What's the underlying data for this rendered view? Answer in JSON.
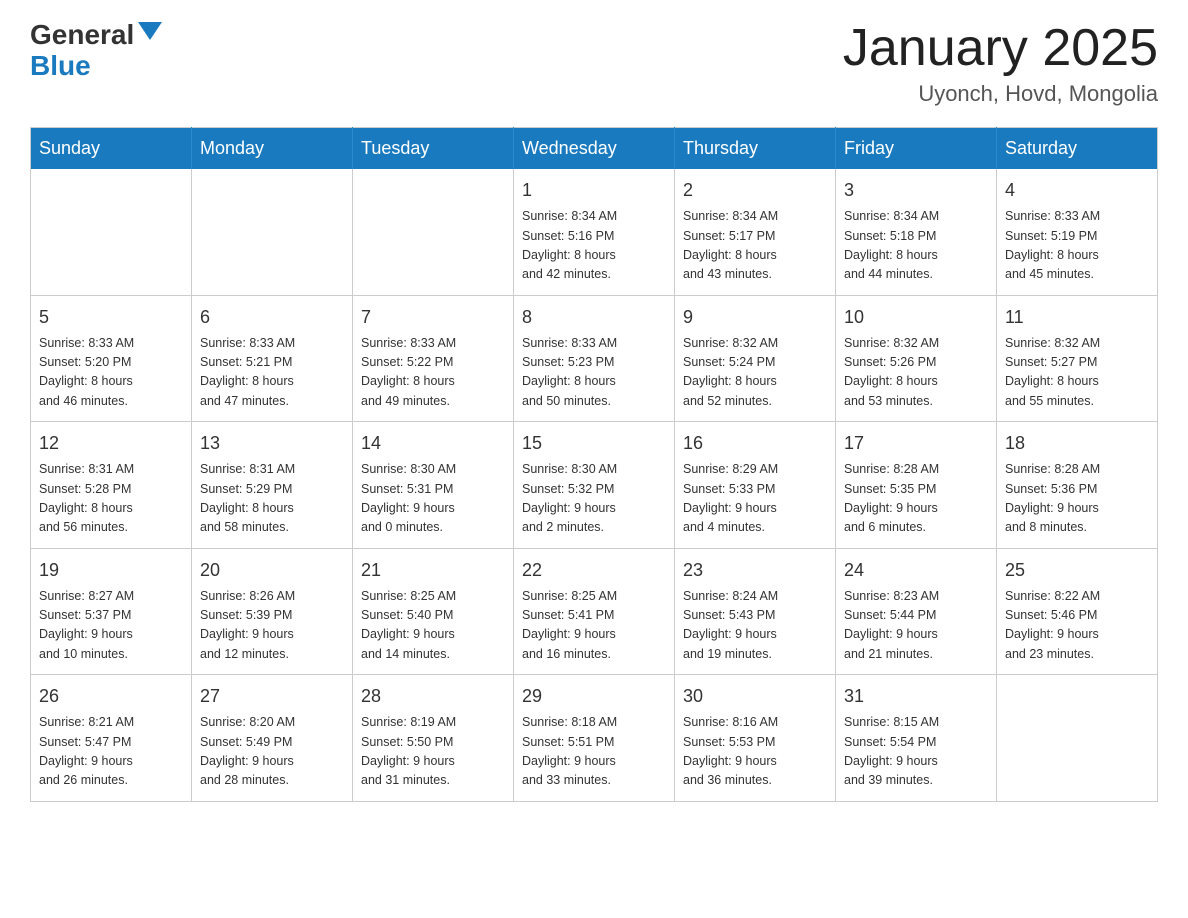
{
  "header": {
    "logo_general": "General",
    "logo_blue": "Blue",
    "title": "January 2025",
    "subtitle": "Uyonch, Hovd, Mongolia"
  },
  "weekdays": [
    "Sunday",
    "Monday",
    "Tuesday",
    "Wednesday",
    "Thursday",
    "Friday",
    "Saturday"
  ],
  "weeks": [
    [
      {
        "day": "",
        "info": ""
      },
      {
        "day": "",
        "info": ""
      },
      {
        "day": "",
        "info": ""
      },
      {
        "day": "1",
        "info": "Sunrise: 8:34 AM\nSunset: 5:16 PM\nDaylight: 8 hours\nand 42 minutes."
      },
      {
        "day": "2",
        "info": "Sunrise: 8:34 AM\nSunset: 5:17 PM\nDaylight: 8 hours\nand 43 minutes."
      },
      {
        "day": "3",
        "info": "Sunrise: 8:34 AM\nSunset: 5:18 PM\nDaylight: 8 hours\nand 44 minutes."
      },
      {
        "day": "4",
        "info": "Sunrise: 8:33 AM\nSunset: 5:19 PM\nDaylight: 8 hours\nand 45 minutes."
      }
    ],
    [
      {
        "day": "5",
        "info": "Sunrise: 8:33 AM\nSunset: 5:20 PM\nDaylight: 8 hours\nand 46 minutes."
      },
      {
        "day": "6",
        "info": "Sunrise: 8:33 AM\nSunset: 5:21 PM\nDaylight: 8 hours\nand 47 minutes."
      },
      {
        "day": "7",
        "info": "Sunrise: 8:33 AM\nSunset: 5:22 PM\nDaylight: 8 hours\nand 49 minutes."
      },
      {
        "day": "8",
        "info": "Sunrise: 8:33 AM\nSunset: 5:23 PM\nDaylight: 8 hours\nand 50 minutes."
      },
      {
        "day": "9",
        "info": "Sunrise: 8:32 AM\nSunset: 5:24 PM\nDaylight: 8 hours\nand 52 minutes."
      },
      {
        "day": "10",
        "info": "Sunrise: 8:32 AM\nSunset: 5:26 PM\nDaylight: 8 hours\nand 53 minutes."
      },
      {
        "day": "11",
        "info": "Sunrise: 8:32 AM\nSunset: 5:27 PM\nDaylight: 8 hours\nand 55 minutes."
      }
    ],
    [
      {
        "day": "12",
        "info": "Sunrise: 8:31 AM\nSunset: 5:28 PM\nDaylight: 8 hours\nand 56 minutes."
      },
      {
        "day": "13",
        "info": "Sunrise: 8:31 AM\nSunset: 5:29 PM\nDaylight: 8 hours\nand 58 minutes."
      },
      {
        "day": "14",
        "info": "Sunrise: 8:30 AM\nSunset: 5:31 PM\nDaylight: 9 hours\nand 0 minutes."
      },
      {
        "day": "15",
        "info": "Sunrise: 8:30 AM\nSunset: 5:32 PM\nDaylight: 9 hours\nand 2 minutes."
      },
      {
        "day": "16",
        "info": "Sunrise: 8:29 AM\nSunset: 5:33 PM\nDaylight: 9 hours\nand 4 minutes."
      },
      {
        "day": "17",
        "info": "Sunrise: 8:28 AM\nSunset: 5:35 PM\nDaylight: 9 hours\nand 6 minutes."
      },
      {
        "day": "18",
        "info": "Sunrise: 8:28 AM\nSunset: 5:36 PM\nDaylight: 9 hours\nand 8 minutes."
      }
    ],
    [
      {
        "day": "19",
        "info": "Sunrise: 8:27 AM\nSunset: 5:37 PM\nDaylight: 9 hours\nand 10 minutes."
      },
      {
        "day": "20",
        "info": "Sunrise: 8:26 AM\nSunset: 5:39 PM\nDaylight: 9 hours\nand 12 minutes."
      },
      {
        "day": "21",
        "info": "Sunrise: 8:25 AM\nSunset: 5:40 PM\nDaylight: 9 hours\nand 14 minutes."
      },
      {
        "day": "22",
        "info": "Sunrise: 8:25 AM\nSunset: 5:41 PM\nDaylight: 9 hours\nand 16 minutes."
      },
      {
        "day": "23",
        "info": "Sunrise: 8:24 AM\nSunset: 5:43 PM\nDaylight: 9 hours\nand 19 minutes."
      },
      {
        "day": "24",
        "info": "Sunrise: 8:23 AM\nSunset: 5:44 PM\nDaylight: 9 hours\nand 21 minutes."
      },
      {
        "day": "25",
        "info": "Sunrise: 8:22 AM\nSunset: 5:46 PM\nDaylight: 9 hours\nand 23 minutes."
      }
    ],
    [
      {
        "day": "26",
        "info": "Sunrise: 8:21 AM\nSunset: 5:47 PM\nDaylight: 9 hours\nand 26 minutes."
      },
      {
        "day": "27",
        "info": "Sunrise: 8:20 AM\nSunset: 5:49 PM\nDaylight: 9 hours\nand 28 minutes."
      },
      {
        "day": "28",
        "info": "Sunrise: 8:19 AM\nSunset: 5:50 PM\nDaylight: 9 hours\nand 31 minutes."
      },
      {
        "day": "29",
        "info": "Sunrise: 8:18 AM\nSunset: 5:51 PM\nDaylight: 9 hours\nand 33 minutes."
      },
      {
        "day": "30",
        "info": "Sunrise: 8:16 AM\nSunset: 5:53 PM\nDaylight: 9 hours\nand 36 minutes."
      },
      {
        "day": "31",
        "info": "Sunrise: 8:15 AM\nSunset: 5:54 PM\nDaylight: 9 hours\nand 39 minutes."
      },
      {
        "day": "",
        "info": ""
      }
    ]
  ]
}
